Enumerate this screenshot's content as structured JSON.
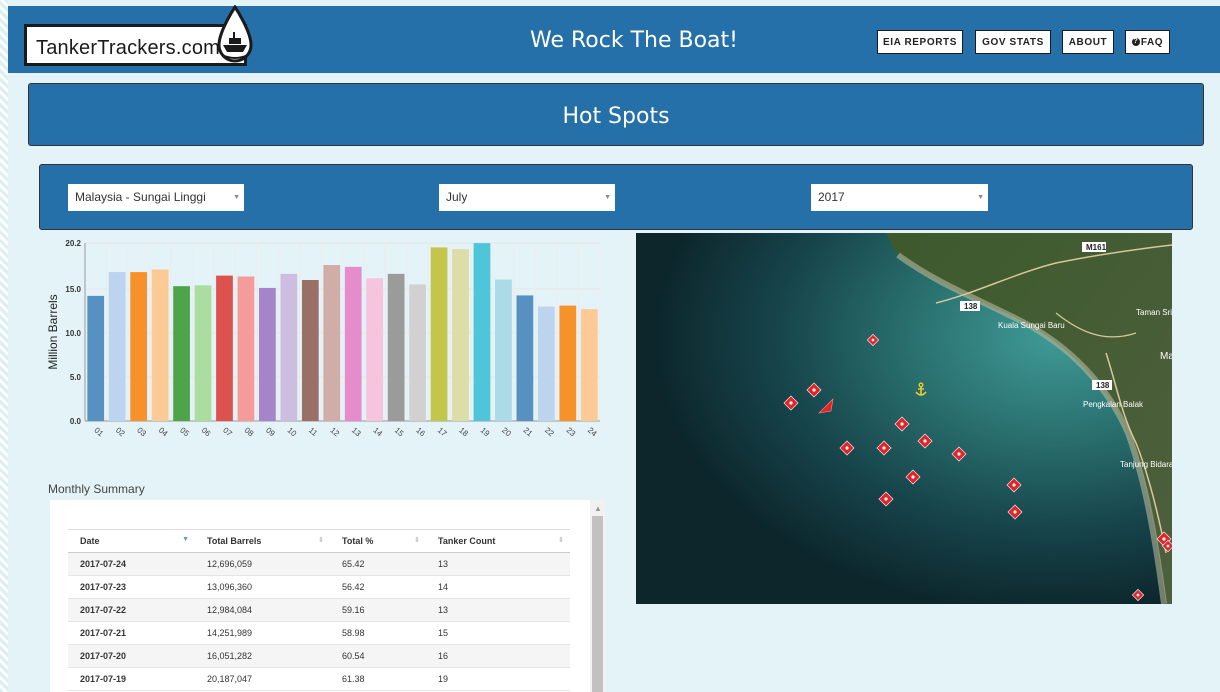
{
  "header": {
    "logo_text": "TankerTrackers.com",
    "tagline": "We Rock The Boat!",
    "nav": [
      "EIA REPORTS",
      "GOV STATS",
      "ABOUT",
      "FAQ"
    ]
  },
  "page_title": "Hot Spots",
  "filters": {
    "location": "Malaysia - Sungai Linggi",
    "month": "July",
    "year": "2017"
  },
  "chart_data": {
    "type": "bar",
    "ylabel": "Million Barrels",
    "xlabel": "",
    "ylim": [
      0,
      20.2
    ],
    "yticks": [
      "0.0",
      "5.0",
      "10.0",
      "15.0",
      "20.2"
    ],
    "categories": [
      "01",
      "02",
      "03",
      "04",
      "05",
      "06",
      "07",
      "08",
      "09",
      "10",
      "11",
      "12",
      "13",
      "14",
      "15",
      "16",
      "17",
      "18",
      "19",
      "20",
      "21",
      "22",
      "23",
      "24"
    ],
    "values": [
      14.2,
      16.9,
      16.9,
      17.2,
      15.3,
      15.4,
      16.5,
      16.4,
      15.1,
      16.7,
      16.0,
      17.7,
      17.5,
      16.2,
      16.7,
      15.5,
      19.7,
      19.5,
      20.187,
      16.051,
      14.252,
      12.984,
      13.096,
      12.696
    ],
    "colors": [
      "#5691c1",
      "#bdd4ee",
      "#f7922b",
      "#fdc994",
      "#4fa34a",
      "#abdda0",
      "#dd514f",
      "#f59c9a",
      "#a585c9",
      "#cdbde0",
      "#9a6f66",
      "#d0ada7",
      "#e58ccc",
      "#f6c4dd",
      "#9b9b9b",
      "#d1d1d1",
      "#c4c64b",
      "#dcdda7",
      "#4ec5d8",
      "#aadbe7",
      "#5691c1",
      "#bdd4ee",
      "#f7922b",
      "#fdc994"
    ]
  },
  "summary": {
    "title": "Monthly Summary",
    "columns": [
      "Date",
      "Total Barrels",
      "Total %",
      "Tanker Count"
    ],
    "rows": [
      [
        "2017-07-24",
        "12,696,059",
        "65.42",
        "13"
      ],
      [
        "2017-07-23",
        "13,096,360",
        "56.42",
        "14"
      ],
      [
        "2017-07-22",
        "12,984,084",
        "59.16",
        "13"
      ],
      [
        "2017-07-21",
        "14,251,989",
        "58.98",
        "15"
      ],
      [
        "2017-07-20",
        "16,051,282",
        "60.54",
        "16"
      ],
      [
        "2017-07-19",
        "20,187,047",
        "61.38",
        "19"
      ]
    ]
  },
  "map": {
    "labels": [
      "M161",
      "138",
      "Kuala Sungai Baru",
      "Taman Sri",
      "Mas",
      "138",
      "Pengkalan Balak",
      "Tanjung Bidara"
    ],
    "icons": [
      "tanker-marker-icon",
      "anchor-icon",
      "vessel-arrow-icon"
    ]
  }
}
